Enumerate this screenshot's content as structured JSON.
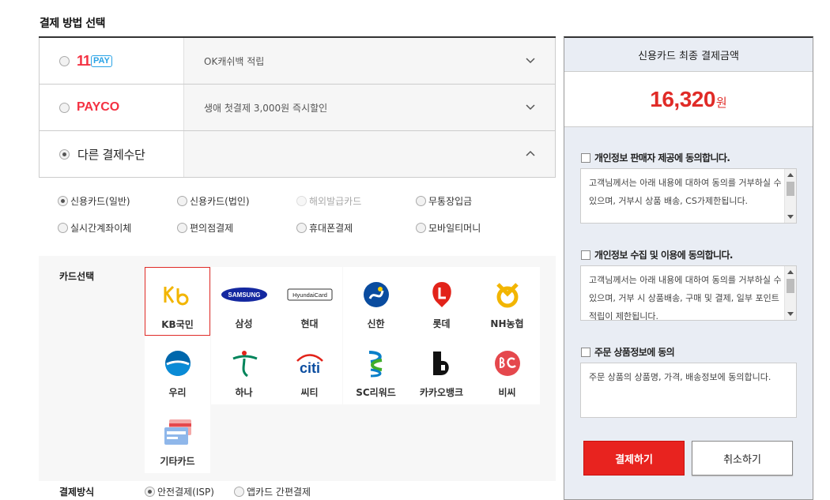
{
  "section_title": "결제 방법 선택",
  "methods": [
    {
      "name_a": "11",
      "name_b": "PAY",
      "desc": "OK캐쉬백 적립"
    },
    {
      "name": "PAYCO",
      "desc": "생애 첫결제 3,000원 즉시할인"
    },
    {
      "name": "다른 결제수단"
    }
  ],
  "options": [
    {
      "label": "신용카드(일반)",
      "selected": true
    },
    {
      "label": "신용카드(법인)"
    },
    {
      "label": "해외발급카드",
      "disabled": true
    },
    {
      "label": "무통장입금"
    },
    {
      "label": "실시간계좌이체"
    },
    {
      "label": "편의점결제"
    },
    {
      "label": "휴대폰결제"
    },
    {
      "label": "모바일티머니"
    }
  ],
  "card_select_label": "카드선택",
  "cards": [
    {
      "name": "KB국민",
      "selected": true,
      "icon": "kb-icon"
    },
    {
      "name": "삼성",
      "icon": "samsung-icon",
      "logo_text": "SAMSUNG"
    },
    {
      "name": "현대",
      "icon": "hyundai-icon",
      "logo_text": "HyundaiCard"
    },
    {
      "name": "신한",
      "icon": "shinhan-icon"
    },
    {
      "name": "롯데",
      "icon": "lotte-icon"
    },
    {
      "name": "NH농협",
      "icon": "nh-icon"
    },
    {
      "name": "우리",
      "icon": "woori-icon"
    },
    {
      "name": "하나",
      "icon": "hana-icon"
    },
    {
      "name": "씨티",
      "icon": "citi-icon",
      "logo_text": "citi"
    },
    {
      "name": "SC리워드",
      "icon": "sc-icon"
    },
    {
      "name": "카카오뱅크",
      "icon": "kakaobank-icon"
    },
    {
      "name": "비씨",
      "icon": "bc-icon"
    },
    {
      "name": "기타카드",
      "icon": "other-card-icon"
    }
  ],
  "pay_way_label": "결제방식",
  "pay_way_options": [
    {
      "label": "안전결제(ISP)",
      "selected": true
    },
    {
      "label": "앱카드 간편결제"
    }
  ],
  "summary": {
    "title": "신용카드 최종 결제금액",
    "amount": "16,320",
    "unit": "원"
  },
  "agreements": [
    {
      "label": "개인정보 판매자 제공에 동의합니다.",
      "text": "고객님께서는 아래 내용에 대하여 동의를 거부하실 수 있으며, 거부시 상품 배송, CS가제한됩니다."
    },
    {
      "label": "개인정보 수집 및 이용에 동의합니다.",
      "text": "고객님께서는 아래 내용에 대하여 동의를 거부하실 수 있으며, 거부 시 상품배송, 구매 및 결제, 일부 포인트 적립이 제한됩니다."
    },
    {
      "label": "주문 상품정보에 동의",
      "text": "주문 상품의 상품명, 가격, 배송정보에 동의합니다."
    }
  ],
  "buttons": {
    "pay": "결제하기",
    "cancel": "취소하기"
  },
  "colors": {
    "accent": "#e8231f",
    "panel_bg": "#e9edf4",
    "eleven": "#f43142",
    "pay_blue": "#2aa3e6"
  }
}
